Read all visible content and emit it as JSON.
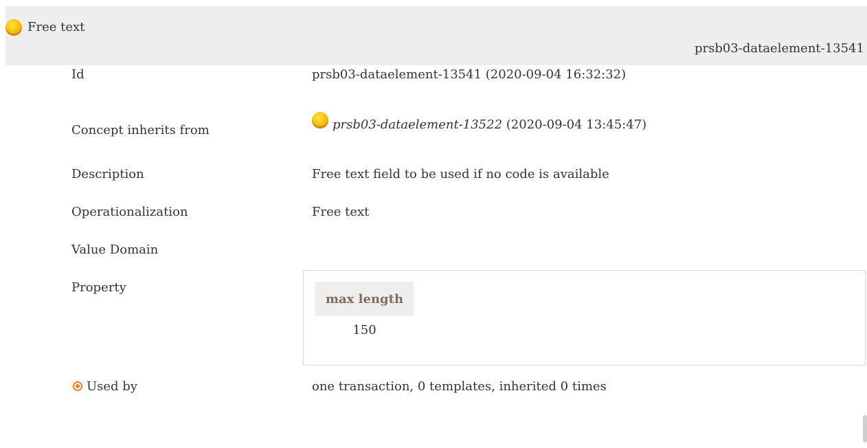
{
  "header": {
    "title": "Free text",
    "id": "prsb03-dataelement-13541",
    "status_icon": "yellow-status-dot-icon"
  },
  "fields": {
    "id": {
      "label": "Id",
      "value": "prsb03-dataelement-13541 (2020-09-04 16:32:32)"
    },
    "inherits": {
      "label": "Concept inherits from",
      "ref": "prsb03-dataelement-13522",
      "date": "(2020-09-04 13:45:47)",
      "icon": "yellow-status-dot-icon"
    },
    "description": {
      "label": "Description",
      "value": "Free text field to be used if no code is available"
    },
    "operationalization": {
      "label": "Operationalization",
      "value": "Free text"
    },
    "value_domain": {
      "label": "Value Domain"
    },
    "property": {
      "label": "Property",
      "header": "max length",
      "value": "150"
    },
    "used_by": {
      "label": "Used by",
      "value": "one transaction, 0 templates, inherited 0 times",
      "icon": "target-icon"
    }
  },
  "colors": {
    "header_bg": "#eeeeee",
    "property_header_text": "#7b6c62",
    "status_yellow": "#ffc10a",
    "target_orange": "#f07c2a"
  }
}
